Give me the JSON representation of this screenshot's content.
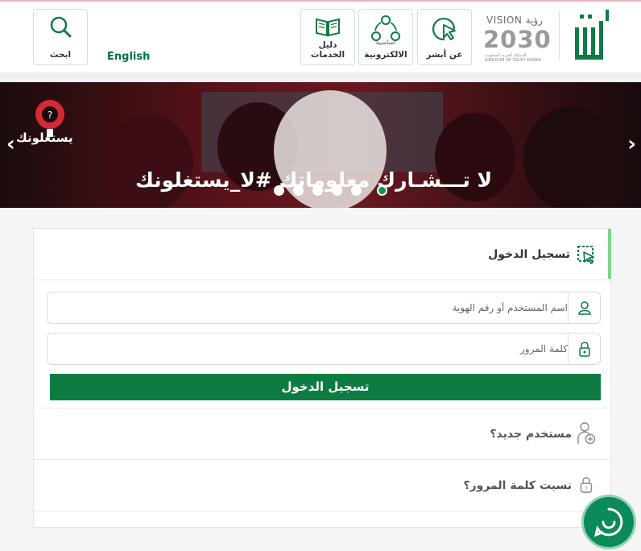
{
  "header": {
    "tiles": {
      "about": "عن أبشر",
      "eservices": "الالكترونية",
      "eservices_top": "اساسية",
      "guide": "دليل الخدمات",
      "search": "ابحث"
    },
    "language": "English",
    "vision": {
      "title": "VISION رؤية",
      "number": "2030",
      "line1": "المملكة العربية السعودية",
      "line2": "KINGDOM OF SAUDI ARABIA"
    },
    "logo_text": "أبشر"
  },
  "banner": {
    "text": "لا تـــشـارك معلوماتك #لا_يستغلونك",
    "badge": "يستغلونك",
    "prev_icon": "chevron-left-icon",
    "next_icon": "chevron-right-icon",
    "slides": 6,
    "active_slide": 6
  },
  "login": {
    "title": "تسجيل الدخول",
    "username_placeholder": "اسم المستخدم أو رقم الهوية",
    "password_placeholder": "كلمة المرور",
    "submit_label": "تسجيل الدخول"
  },
  "links": {
    "new_user": "مستخدم جديد؟",
    "forgot_password": "نسيت كلمة المرور؟"
  },
  "colors": {
    "primary_green": "#0c7c43",
    "accent_green": "#7ed48a",
    "chat_green": "#0b8a5a"
  }
}
